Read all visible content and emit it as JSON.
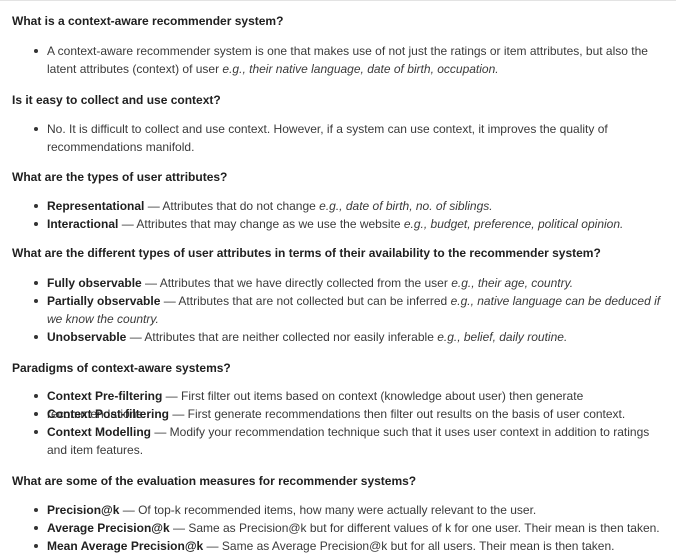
{
  "sections": [
    {
      "question": "What is a context-aware recommender system?",
      "items": [
        {
          "term": "",
          "sep": "",
          "text": "A context-aware recommender system is one that makes use of not just the ratings or item attributes, but also the latent attributes (context) of user ",
          "example": "e.g., their native language, date of birth, occupation.",
          "tail": ""
        }
      ]
    },
    {
      "question": "Is it easy to collect and use context?",
      "items": [
        {
          "term": "",
          "sep": "",
          "text": "No. It is difficult to collect and use context. However, if a system can use context, it improves the quality of recommendations manifold.",
          "example": "",
          "tail": ""
        }
      ]
    },
    {
      "question": "What are the types of user attributes?",
      "items": [
        {
          "term": "Representational",
          "sep": " — ",
          "text": "Attributes that do not change ",
          "example": "e.g., date of birth, no. of siblings.",
          "tail": ""
        },
        {
          "term": "Interactional",
          "sep": " — ",
          "text": "Attributes that may change as we use the website ",
          "example": "e.g., budget, preference, political opinion.",
          "tail": ""
        }
      ]
    },
    {
      "question": "What are the different types of user attributes in terms of their availability to the recommender system?",
      "items": [
        {
          "term": "Fully observable",
          "sep": " — ",
          "text": "Attributes that we have directly collected from the user ",
          "example": "e.g., their age, country.",
          "tail": ""
        },
        {
          "term": "Partially observable",
          "sep": " — ",
          "text": "Attributes that are not collected but can be inferred ",
          "example": "e.g., native language can be deduced if we know the country.",
          "tail": ""
        },
        {
          "term": "Unobservable",
          "sep": " — ",
          "text": "Attributes that are neither collected nor easily inferable ",
          "example": "e.g., belief, daily routine.",
          "tail": ""
        }
      ]
    },
    {
      "question": "Paradigms of context-aware systems?",
      "items": [
        {
          "term": "Context Pre-filtering",
          "sep": " — ",
          "text": "First filter out items based on context (knowledge about user) then generate recommendations.",
          "example": "",
          "tail": ""
        },
        {
          "term": "Context Post-filtering",
          "sep": " — ",
          "text": "First generate recommendations then filter out results on the basis of user context.",
          "example": "",
          "tail": ""
        },
        {
          "term": "Context Modelling",
          "sep": " — ",
          "text": "Modify your recommendation technique such that it uses user context in addition to ratings and item features.",
          "example": "",
          "tail": ""
        }
      ]
    },
    {
      "question": "What are some of the evaluation measures for recommender systems?",
      "items": [
        {
          "term": "Precision@k",
          "sep": " — ",
          "text": "Of top-k recommended items, how many were actually relevant to the user.",
          "example": "",
          "tail": ""
        },
        {
          "term": "Average Precision@k",
          "sep": " — ",
          "text": "Same as Precision@k but for different values of k for one user. Their mean is then taken.",
          "example": "",
          "tail": ""
        },
        {
          "term": "Mean Average Precision@k",
          "sep": " — ",
          "text": "Same as Average Precision@k but for all users. Their mean is then taken.",
          "example": "",
          "tail": ""
        }
      ]
    }
  ]
}
